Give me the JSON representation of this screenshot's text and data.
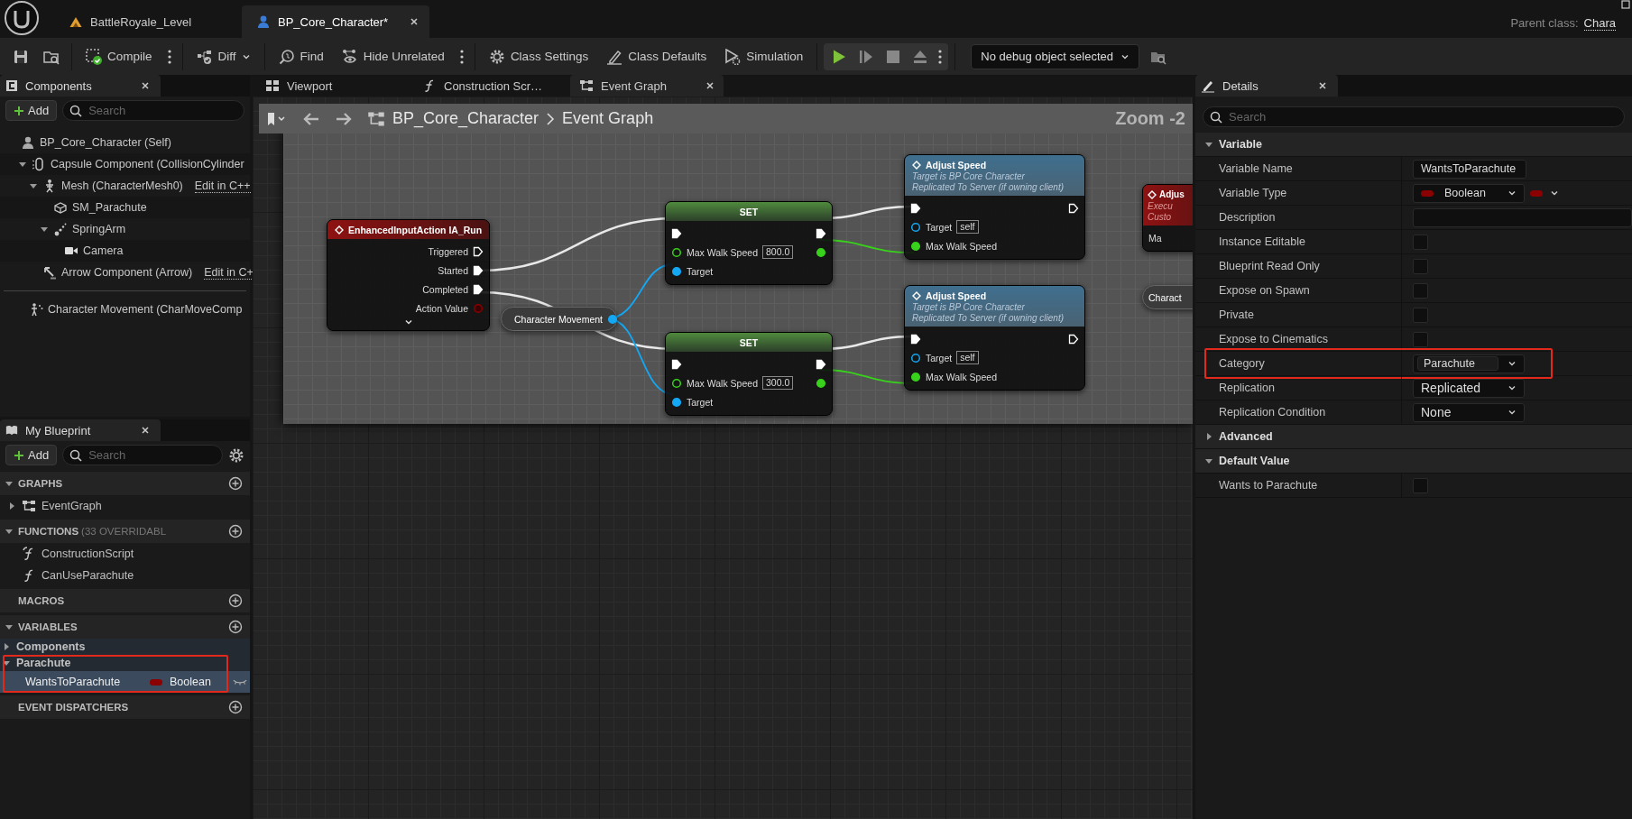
{
  "app_tabs": [
    {
      "label": "BattleRoyale_Level",
      "kind": "level",
      "selected": false
    },
    {
      "label": "BP_Core_Character*",
      "kind": "blueprint",
      "selected": true
    }
  ],
  "parent_class": {
    "label": "Parent class:",
    "value": "Chara"
  },
  "toolbar": {
    "buttons": [
      {
        "kind": "compile",
        "label": "Compile",
        "more": true
      },
      {
        "kind": "diff",
        "label": "Diff",
        "dropdown": true
      },
      {
        "kind": "find",
        "label": "Find"
      },
      {
        "kind": "hide",
        "label": "Hide Unrelated",
        "more": true
      },
      {
        "kind": "settings",
        "label": "Class Settings"
      },
      {
        "kind": "defaults",
        "label": "Class Defaults"
      },
      {
        "kind": "simulation",
        "label": "Simulation"
      }
    ],
    "debug_object": "No debug object selected"
  },
  "components": {
    "title": "Components",
    "add_label": "Add",
    "search_placeholder": "Search",
    "tree": [
      {
        "label": "BP_Core_Character (Self)",
        "kind": "self",
        "children": [
          {
            "label": "Capsule Component (CollisionCylinder",
            "kind": "capsule",
            "expanded": true,
            "children": [
              {
                "label": "Mesh (CharacterMesh0)",
                "kind": "mesh",
                "expanded": true,
                "link": "Edit in C++",
                "children": [
                  {
                    "label": "SM_Parachute",
                    "kind": "staticmesh"
                  },
                  {
                    "label": "SpringArm",
                    "kind": "springarm",
                    "expanded": true,
                    "children": [
                      {
                        "label": "Camera",
                        "kind": "camera"
                      }
                    ]
                  }
                ]
              },
              {
                "label": "Arrow Component (Arrow)",
                "kind": "arrow",
                "link": "Edit in C+"
              }
            ]
          }
        ]
      }
    ],
    "movement": [
      {
        "label": "Character Movement (CharMoveComp",
        "kind": "movement"
      }
    ]
  },
  "my_blueprint": {
    "title": "My Blueprint",
    "add_label": "Add",
    "search_placeholder": "Search",
    "sections": [
      {
        "title": "GRAPHS",
        "expanded": true,
        "items": [
          {
            "label": "EventGraph",
            "kind": "graph",
            "expanded": false
          }
        ]
      },
      {
        "title": "FUNCTIONS",
        "note": "(33 OVERRIDABL",
        "expanded": true,
        "items": [
          {
            "label": "ConstructionScript",
            "kind": "construction"
          },
          {
            "label": "CanUseParachute",
            "kind": "function"
          }
        ]
      },
      {
        "title": "MACROS"
      },
      {
        "title": "VARIABLES",
        "expanded": true,
        "items": [
          {
            "label": "Components",
            "kind": "category",
            "expanded": false
          },
          {
            "label": "Parachute",
            "kind": "category",
            "expanded": true,
            "highlighted": true,
            "children": [
              {
                "label": "WantsToParachute",
                "type": "Boolean",
                "color": "#8b0000",
                "selected": true
              }
            ]
          }
        ]
      },
      {
        "title": "EVENT DISPATCHERS"
      }
    ]
  },
  "graph": {
    "tabs": [
      {
        "label": "Viewport",
        "kind": "viewport",
        "selected": false
      },
      {
        "label": "Construction Scr…",
        "kind": "function",
        "selected": false
      },
      {
        "label": "Event Graph",
        "kind": "graph",
        "selected": true
      }
    ],
    "breadcrumb": [
      "BP_Core_Character",
      "Event Graph"
    ],
    "zoom": "Zoom -2",
    "nodes": [
      {
        "kind": "event",
        "title": "EnhancedInputAction IA_Run",
        "expandable": true,
        "rows": [
          {
            "out": {
              "label": "Triggered",
              "kind": "exec",
              "connected": false
            }
          },
          {
            "out": {
              "label": "Started",
              "kind": "exec",
              "connected": true
            }
          },
          {
            "out": {
              "label": "Completed",
              "kind": "exec",
              "connected": true
            }
          },
          {
            "out": {
              "label": "Action Value",
              "kind": "bool",
              "connected": false
            }
          }
        ]
      },
      {
        "kind": "getter",
        "title": "Character Movement",
        "pin": {
          "kind": "object",
          "connected": true
        }
      },
      {
        "kind": "set",
        "title": "SET",
        "rows": [
          {
            "in": {
              "kind": "exec",
              "connected": true
            },
            "out": {
              "kind": "exec",
              "connected": true
            }
          },
          {
            "in": {
              "label": "Max Walk Speed",
              "kind": "float",
              "value": "800.0",
              "connected": false
            },
            "out": {
              "kind": "float",
              "connected": true
            }
          },
          {
            "in": {
              "label": "Target",
              "kind": "object",
              "connected": true
            }
          }
        ]
      },
      {
        "kind": "function",
        "title": "Adjust Speed",
        "subtitle": [
          "Target is BP Core Character",
          "Replicated To Server (if owning client)"
        ],
        "rows": [
          {
            "in": {
              "kind": "exec",
              "connected": true
            },
            "out": {
              "kind": "exec",
              "connected": false
            }
          },
          {
            "in": {
              "label": "Target",
              "kind": "object",
              "value": "self",
              "connected": false
            }
          },
          {
            "in": {
              "label": "Max Walk Speed",
              "kind": "float",
              "connected": true
            }
          }
        ]
      },
      {
        "kind": "set",
        "title": "SET",
        "rows": [
          {
            "in": {
              "kind": "exec",
              "connected": true
            },
            "out": {
              "kind": "exec",
              "connected": true
            }
          },
          {
            "in": {
              "label": "Max Walk Speed",
              "kind": "float",
              "value": "300.0",
              "connected": false
            },
            "out": {
              "kind": "float",
              "connected": true
            }
          },
          {
            "in": {
              "label": "Target",
              "kind": "object",
              "connected": true
            }
          }
        ]
      },
      {
        "kind": "function",
        "title": "Adjust Speed",
        "subtitle": [
          "Target is BP Core Character",
          "Replicated To Server (if owning client)"
        ],
        "rows": [
          {
            "in": {
              "kind": "exec",
              "connected": true
            },
            "out": {
              "kind": "exec",
              "connected": false
            }
          },
          {
            "in": {
              "label": "Target",
              "kind": "object",
              "value": "self",
              "connected": false
            }
          },
          {
            "in": {
              "label": "Max Walk Speed",
              "kind": "float",
              "connected": true
            }
          }
        ]
      },
      {
        "kind": "custom_event",
        "title": "Adjus",
        "subtitle": [
          "Execu",
          "Custo"
        ],
        "rows": [
          {
            "in": {
              "label": "Ma"
            }
          }
        ]
      },
      {
        "kind": "getter",
        "title": "Charact"
      }
    ]
  },
  "details": {
    "title": "Details",
    "search_placeholder": "Search",
    "sections": [
      {
        "title": "Variable",
        "expanded": true,
        "rows": [
          {
            "label": "Variable Name",
            "kind": "text",
            "value": "WantsToParachute"
          },
          {
            "label": "Variable Type",
            "kind": "type",
            "value": "Boolean",
            "color": "#8b0000"
          },
          {
            "label": "Description",
            "kind": "textarea"
          },
          {
            "label": "Instance Editable",
            "kind": "checkbox",
            "checked": false
          },
          {
            "label": "Blueprint Read Only",
            "kind": "checkbox",
            "checked": false
          },
          {
            "label": "Expose on Spawn",
            "kind": "checkbox",
            "checked": false
          },
          {
            "label": "Private",
            "kind": "checkbox",
            "checked": false
          },
          {
            "label": "Expose to Cinematics",
            "kind": "checkbox",
            "checked": false
          },
          {
            "label": "Category",
            "kind": "combo",
            "value": "Parachute",
            "highlighted": true
          },
          {
            "label": "Replication",
            "kind": "dropdown",
            "value": "Replicated"
          },
          {
            "label": "Replication Condition",
            "kind": "dropdown",
            "value": "None"
          }
        ]
      },
      {
        "title": "Advanced",
        "expanded": false
      },
      {
        "title": "Default Value",
        "expanded": true,
        "rows": [
          {
            "label": "Wants to Parachute",
            "kind": "checkbox",
            "checked": false
          }
        ]
      }
    ]
  }
}
